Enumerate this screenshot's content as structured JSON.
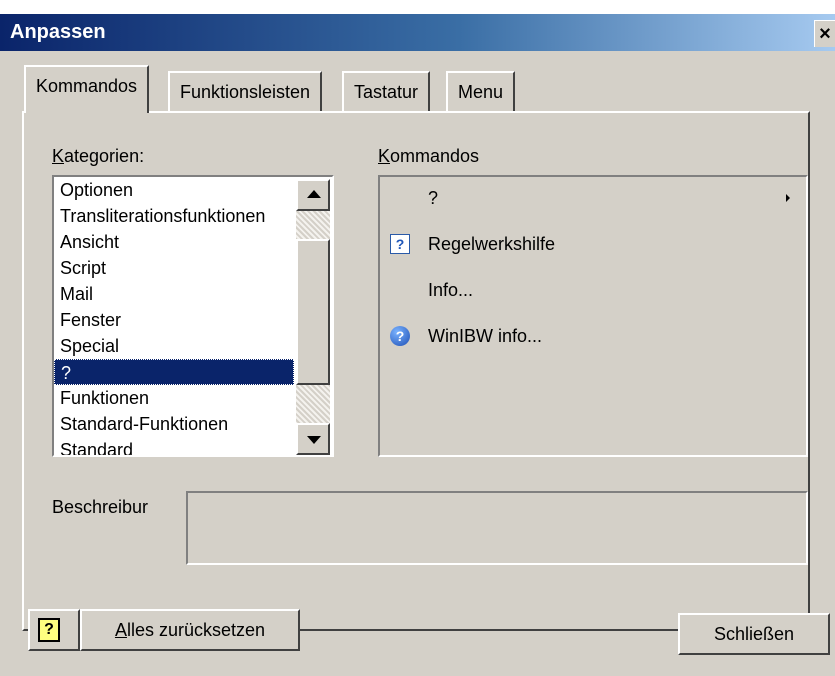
{
  "window": {
    "title": "Anpassen",
    "close_glyph": "×"
  },
  "tabs": [
    {
      "label": "Kommandos",
      "active": true
    },
    {
      "label": "Funktionsleisten",
      "active": false
    },
    {
      "label": "Tastatur",
      "active": false
    },
    {
      "label": "Menu",
      "active": false
    }
  ],
  "categories": {
    "label_prefix": "K",
    "label_rest": "ategorien:",
    "items": [
      "Optionen",
      "Transliterationsfunktionen",
      "Ansicht",
      "Script",
      "Mail",
      "Fenster",
      "Special",
      "?",
      "Funktionen",
      "Standard-Funktionen",
      "Standard"
    ],
    "selected_index": 7
  },
  "commands": {
    "label_prefix": "K",
    "label_rest": "ommandos",
    "items": [
      {
        "text": "?",
        "icon": "none",
        "submenu": true
      },
      {
        "text": "Regelwerkshilfe",
        "icon": "help-icon",
        "submenu": false
      },
      {
        "text": "Info...",
        "icon": "none",
        "submenu": false
      },
      {
        "text": "WinIBW info...",
        "icon": "info-icon",
        "submenu": false
      }
    ],
    "help_icon_glyph": "?",
    "info_icon_glyph": "?"
  },
  "description": {
    "label": "Beschreibur",
    "value": ""
  },
  "buttons": {
    "help_glyph": "?",
    "reset_prefix": "A",
    "reset_rest": "lles zurücksetzen",
    "close_label": "Schließen"
  },
  "colors": {
    "dialog_bg": "#d4d0c8",
    "title_gradient_start": "#0a246a",
    "title_gradient_end": "#a6caf0",
    "selection_bg": "#0a246a"
  }
}
